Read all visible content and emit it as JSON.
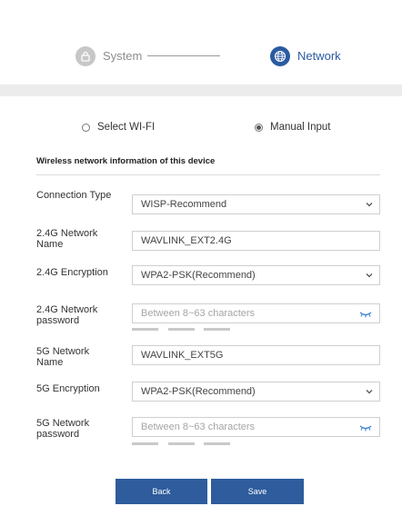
{
  "stepper": {
    "steps": [
      {
        "label": "System",
        "icon": "lock-icon",
        "state": "inactive"
      },
      {
        "label": "Network",
        "icon": "globe-icon",
        "state": "active"
      }
    ]
  },
  "mode": {
    "options": [
      {
        "label": "Select WI-FI",
        "selected": false
      },
      {
        "label": "Manual Input",
        "selected": true
      }
    ]
  },
  "section": {
    "title": "Wireless network information of this device"
  },
  "fields": {
    "connection_type": {
      "label": "Connection Type",
      "value": "WISP-Recommend"
    },
    "ssid_24": {
      "label": "2.4G Network Name",
      "value": "WAVLINK_EXT2.4G"
    },
    "enc_24": {
      "label": "2.4G Encryption",
      "value": "WPA2-PSK(Recommend)"
    },
    "pwd_24": {
      "label": "2.4G Network password",
      "placeholder": "Between 8~63 characters"
    },
    "ssid_5": {
      "label": "5G Network Name",
      "value": "WAVLINK_EXT5G"
    },
    "enc_5": {
      "label": "5G Encryption",
      "value": "WPA2-PSK(Recommend)"
    },
    "pwd_5": {
      "label": "5G Network password",
      "placeholder": "Between 8~63 characters"
    }
  },
  "buttons": {
    "back": "Back",
    "save": "Save"
  },
  "colors": {
    "accent": "#2b5aa0",
    "button": "#2e5c9c",
    "inactive": "#c7c7c7"
  }
}
